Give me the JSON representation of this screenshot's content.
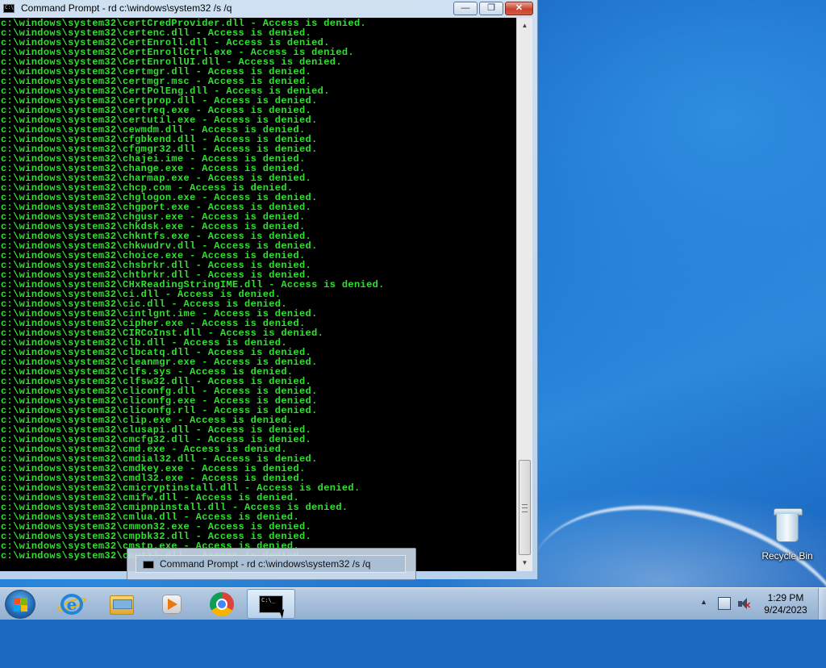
{
  "window": {
    "title": "Command Prompt - rd  c:\\windows\\system32 /s /q",
    "minimize_glyph": "—",
    "maximize_glyph": "❐",
    "close_glyph": "✕",
    "icon": "console-icon"
  },
  "console": {
    "text_color": "#30e030",
    "background": "#000000",
    "lines": [
      "c:\\windows\\system32\\certCredProvider.dll - Access is denied.",
      "c:\\windows\\system32\\certenc.dll - Access is denied.",
      "c:\\windows\\system32\\CertEnroll.dll - Access is denied.",
      "c:\\windows\\system32\\CertEnrollCtrl.exe - Access is denied.",
      "c:\\windows\\system32\\CertEnrollUI.dll - Access is denied.",
      "c:\\windows\\system32\\certmgr.dll - Access is denied.",
      "c:\\windows\\system32\\certmgr.msc - Access is denied.",
      "c:\\windows\\system32\\CertPolEng.dll - Access is denied.",
      "c:\\windows\\system32\\certprop.dll - Access is denied.",
      "c:\\windows\\system32\\certreq.exe - Access is denied.",
      "c:\\windows\\system32\\certutil.exe - Access is denied.",
      "c:\\windows\\system32\\cewmdm.dll - Access is denied.",
      "c:\\windows\\system32\\cfgbkend.dll - Access is denied.",
      "c:\\windows\\system32\\cfgmgr32.dll - Access is denied.",
      "c:\\windows\\system32\\chajei.ime - Access is denied.",
      "c:\\windows\\system32\\change.exe - Access is denied.",
      "c:\\windows\\system32\\charmap.exe - Access is denied.",
      "c:\\windows\\system32\\chcp.com - Access is denied.",
      "c:\\windows\\system32\\chglogon.exe - Access is denied.",
      "c:\\windows\\system32\\chgport.exe - Access is denied.",
      "c:\\windows\\system32\\chgusr.exe - Access is denied.",
      "c:\\windows\\system32\\chkdsk.exe - Access is denied.",
      "c:\\windows\\system32\\chkntfs.exe - Access is denied.",
      "c:\\windows\\system32\\chkwudrv.dll - Access is denied.",
      "c:\\windows\\system32\\choice.exe - Access is denied.",
      "c:\\windows\\system32\\chsbrkr.dll - Access is denied.",
      "c:\\windows\\system32\\chtbrkr.dll - Access is denied.",
      "c:\\windows\\system32\\CHxReadingStringIME.dll - Access is denied.",
      "c:\\windows\\system32\\ci.dll - Access is denied.",
      "c:\\windows\\system32\\cic.dll - Access is denied.",
      "c:\\windows\\system32\\cintlgnt.ime - Access is denied.",
      "c:\\windows\\system32\\cipher.exe - Access is denied.",
      "c:\\windows\\system32\\CIRCoInst.dll - Access is denied.",
      "c:\\windows\\system32\\clb.dll - Access is denied.",
      "c:\\windows\\system32\\clbcatq.dll - Access is denied.",
      "c:\\windows\\system32\\cleanmgr.exe - Access is denied.",
      "c:\\windows\\system32\\clfs.sys - Access is denied.",
      "c:\\windows\\system32\\clfsw32.dll - Access is denied.",
      "c:\\windows\\system32\\cliconfg.dll - Access is denied.",
      "c:\\windows\\system32\\cliconfg.exe - Access is denied.",
      "c:\\windows\\system32\\cliconfg.rll - Access is denied.",
      "c:\\windows\\system32\\clip.exe - Access is denied.",
      "c:\\windows\\system32\\clusapi.dll - Access is denied.",
      "c:\\windows\\system32\\cmcfg32.dll - Access is denied.",
      "c:\\windows\\system32\\cmd.exe - Access is denied.",
      "c:\\windows\\system32\\cmdial32.dll - Access is denied.",
      "c:\\windows\\system32\\cmdkey.exe - Access is denied.",
      "c:\\windows\\system32\\cmdl32.exe - Access is denied.",
      "c:\\windows\\system32\\cmicryptinstall.dll - Access is denied.",
      "c:\\windows\\system32\\cmifw.dll - Access is denied.",
      "c:\\windows\\system32\\cmipnpinstall.dll - Access is denied.",
      "c:\\windows\\system32\\cmlua.dll - Access is denied.",
      "c:\\windows\\system32\\cmmon32.exe - Access is denied.",
      "c:\\windows\\system32\\cmpbk32.dll - Access is denied.",
      "c:\\windows\\system32\\cmstp.exe - Access is denied.",
      "c:\\windows\\system32\\cmutil.dll - Access is denied."
    ]
  },
  "tooltip": {
    "text": "Command Prompt - rd  c:\\windows\\system32 /s /q"
  },
  "desktop": {
    "recycle_bin_label": "Recycle Bin"
  },
  "taskbar": {
    "items": [
      {
        "name": "internet-explorer",
        "icon": "internet-explorer-icon"
      },
      {
        "name": "windows-explorer",
        "icon": "folder-icon"
      },
      {
        "name": "windows-media-player",
        "icon": "media-player-icon"
      },
      {
        "name": "google-chrome",
        "icon": "chrome-icon"
      },
      {
        "name": "command-prompt",
        "icon": "console-icon"
      }
    ],
    "clock_time": "1:29 PM",
    "clock_date": "9/24/2023",
    "tray_arrow": "▲"
  }
}
